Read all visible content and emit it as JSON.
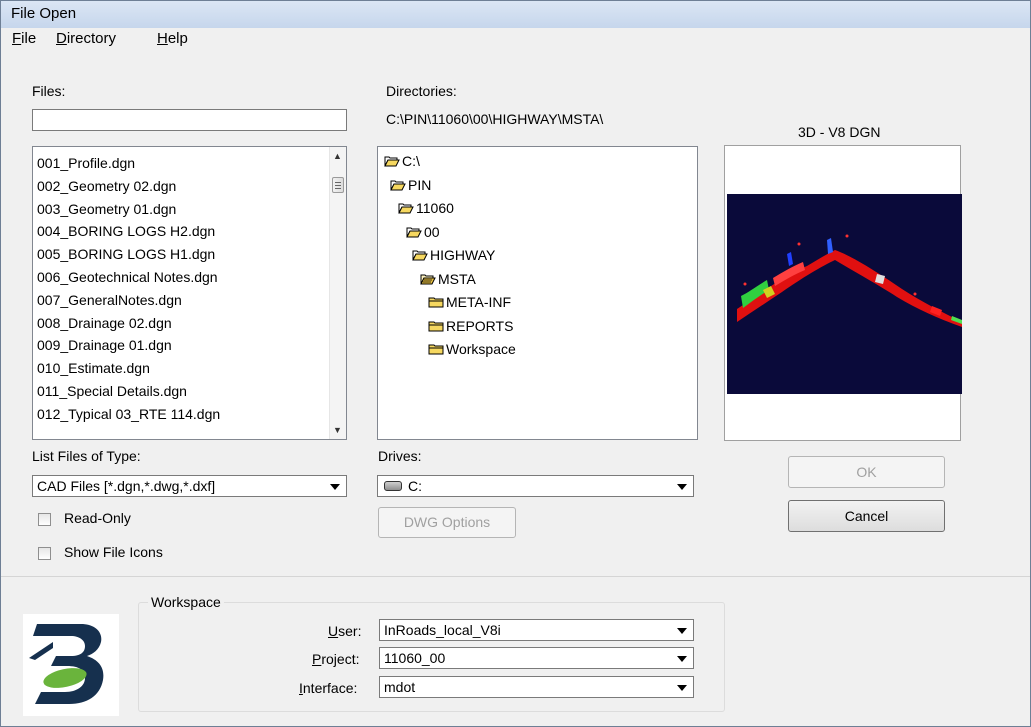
{
  "window": {
    "title": "File Open"
  },
  "menu": [
    {
      "label": "File"
    },
    {
      "label": "Directory"
    },
    {
      "label": "Help"
    }
  ],
  "files": {
    "label": "Files:",
    "filter_value": "",
    "items": [
      "001_Profile.dgn",
      "002_Geometry 02.dgn",
      "003_Geometry 01.dgn",
      "004_BORING LOGS H2.dgn",
      "005_BORING LOGS H1.dgn",
      "006_Geotechnical Notes.dgn",
      "007_GeneralNotes.dgn",
      "008_Drainage 02.dgn",
      "009_Drainage 01.dgn",
      "010_Estimate.dgn",
      "011_Special Details.dgn",
      "012_Typical 03_RTE 114.dgn"
    ]
  },
  "directories": {
    "label": "Directories:",
    "current_path": "C:\\PIN\\11060\\00\\HIGHWAY\\MSTA\\",
    "tree": [
      {
        "name": "C:\\",
        "icon": "open-folder-icon"
      },
      {
        "name": "PIN",
        "icon": "open-folder-icon"
      },
      {
        "name": "11060",
        "icon": "open-folder-icon"
      },
      {
        "name": "00",
        "icon": "open-folder-icon"
      },
      {
        "name": "HIGHWAY",
        "icon": "open-folder-icon"
      },
      {
        "name": "MSTA",
        "icon": "open-folder-selected-icon"
      },
      {
        "name": "META-INF",
        "icon": "closed-folder-icon"
      },
      {
        "name": "REPORTS",
        "icon": "closed-folder-icon"
      },
      {
        "name": "Workspace",
        "icon": "closed-folder-icon"
      }
    ]
  },
  "preview": {
    "label": "3D - V8 DGN",
    "background_color": "#0a0a3a"
  },
  "file_type": {
    "label": "List Files of Type:",
    "value": "CAD Files [*.dgn,*.dwg,*.dxf]"
  },
  "drives": {
    "label": "Drives:",
    "value": "C:",
    "icon": "drive-icon"
  },
  "buttons": {
    "ok": "OK",
    "cancel": "Cancel",
    "dwg_options": "DWG Options"
  },
  "options": {
    "read_only": {
      "label": "Read-Only",
      "checked": false
    },
    "show_icons": {
      "label": "Show File Icons",
      "checked": false
    }
  },
  "workspace": {
    "group_label": "Workspace",
    "user_label": "User:",
    "user_value": "InRoads_local_V8i",
    "project_label": "Project:",
    "project_value": "11060_00",
    "interface_label": "Interface:",
    "interface_value": "mdot"
  },
  "logo": {
    "icon": "bentley-logo-icon"
  }
}
